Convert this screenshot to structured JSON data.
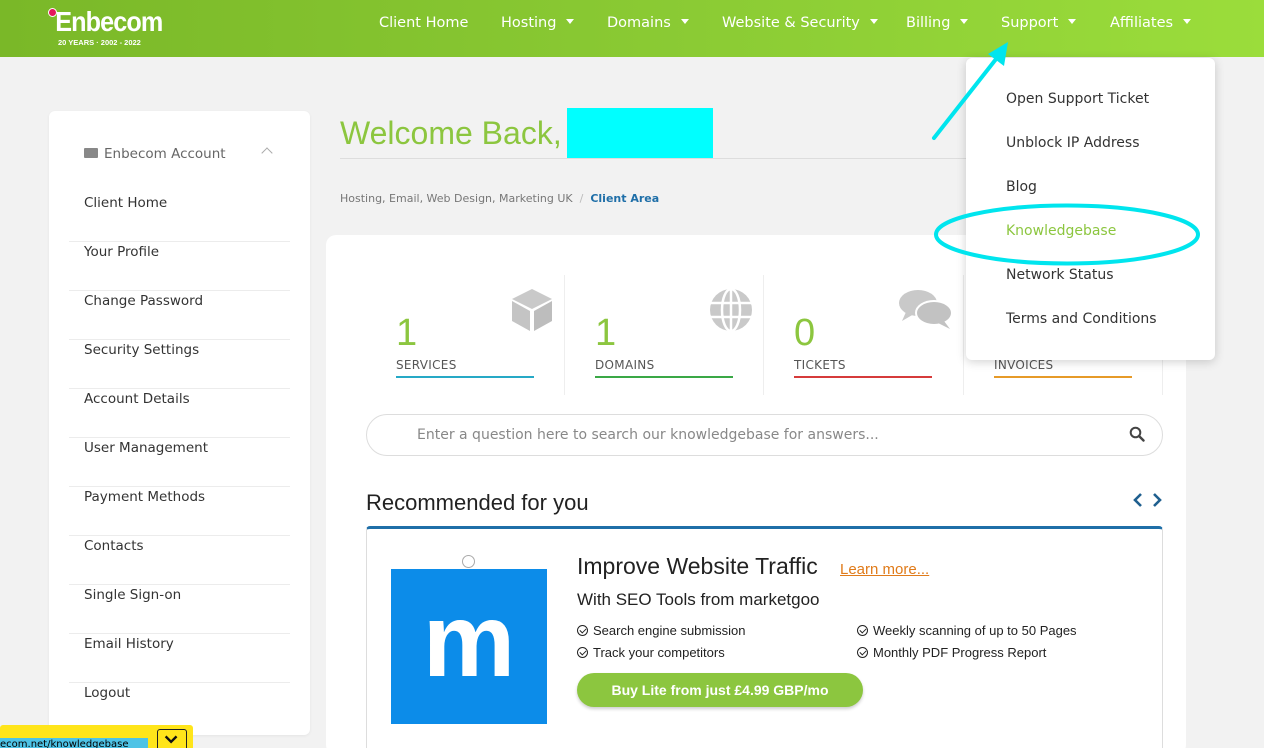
{
  "brand": {
    "name": "Enbecom",
    "tagline": "20 YEARS · 2002 - 2022",
    "accent": "#8cc63f"
  },
  "nav": {
    "items": [
      {
        "label": "Client Home",
        "caret": false
      },
      {
        "label": "Hosting",
        "caret": true
      },
      {
        "label": "Domains",
        "caret": true
      },
      {
        "label": "Website & Security",
        "caret": true
      },
      {
        "label": "Billing",
        "caret": true
      },
      {
        "label": "Support",
        "caret": true
      },
      {
        "label": "Affiliates",
        "caret": true
      }
    ]
  },
  "support_menu": {
    "items": [
      {
        "label": "Open Support Ticket"
      },
      {
        "label": "Unblock IP Address"
      },
      {
        "label": "Blog"
      },
      {
        "label": "Knowledgebase"
      },
      {
        "label": "Network Status"
      },
      {
        "label": "Terms and Conditions"
      }
    ]
  },
  "sidebar": {
    "header": "Enbecom Account",
    "items": [
      {
        "label": "Client Home"
      },
      {
        "label": "Your Profile"
      },
      {
        "label": "Change Password"
      },
      {
        "label": "Security Settings"
      },
      {
        "label": "Account Details"
      },
      {
        "label": "User Management"
      },
      {
        "label": "Payment Methods"
      },
      {
        "label": "Contacts"
      },
      {
        "label": "Single Sign-on"
      },
      {
        "label": "Email History"
      },
      {
        "label": "Logout"
      }
    ]
  },
  "welcome": {
    "text": "Welcome Back,"
  },
  "breadcrumb": {
    "root": "Hosting, Email, Web Design, Marketing UK",
    "separator": "/",
    "current": "Client Area"
  },
  "stats": [
    {
      "value": "1",
      "label": "SERVICES",
      "color": "#26a9c6",
      "icon": "box-icon"
    },
    {
      "value": "1",
      "label": "DOMAINS",
      "color": "#3aa846",
      "icon": "globe-icon"
    },
    {
      "value": "0",
      "label": "TICKETS",
      "color": "#d63b3b",
      "icon": "comments-icon"
    },
    {
      "value": "",
      "label": "INVOICES",
      "color": "#e69a28",
      "icon": "invoice-icon"
    }
  ],
  "search": {
    "placeholder": "Enter a question here to search our knowledgebase for answers..."
  },
  "recommended": {
    "title": "Recommended for you",
    "promo": {
      "logo_letter": "m",
      "title": "Improve Website Traffic",
      "learn_more": "Learn more...",
      "subtitle": "With SEO Tools from marketgoo",
      "features": [
        "Search engine submission",
        "Track your competitors",
        "Weekly scanning of up to 50 Pages",
        "Monthly PDF Progress Report"
      ],
      "cta": "Buy Lite from just £4.99 GBP/mo"
    }
  },
  "status_bar": {
    "url": "ecom.net/knowledgebase"
  },
  "annotation": {
    "color": "#00e5ee"
  }
}
